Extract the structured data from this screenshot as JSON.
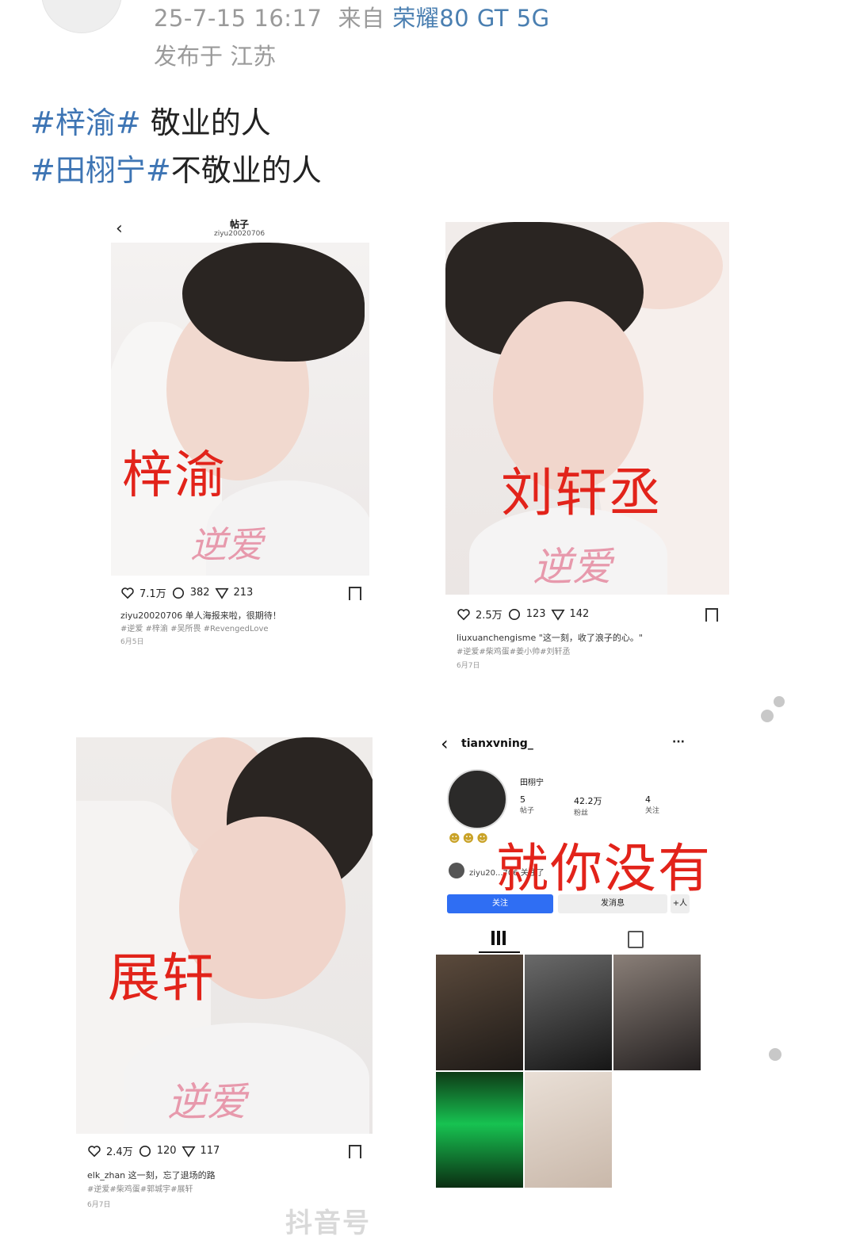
{
  "post": {
    "timestamp": "25-7-15 16:17",
    "source_prefix": "来自",
    "device": "荣耀80 GT 5G",
    "location": "发布于 江苏",
    "lines": [
      {
        "tag": "#梓渝#",
        "text": " 敬业的人"
      },
      {
        "tag": "#田栩宁#",
        "text": "不敬业的人"
      }
    ]
  },
  "cards": {
    "card1": {
      "nav_back": "‹",
      "nav_title": "帖子",
      "nav_user": "ziyu20020706",
      "label": "梓渝",
      "poster_script": "逆爱",
      "likes": "7.1万",
      "comments": "382",
      "shares": "213",
      "caption": "ziyu20020706 单人海报来啦，很期待！",
      "hashtags": "#逆爱 #梓渝 #吴所畏 #RevengedLove",
      "date": "6月5日"
    },
    "card2": {
      "label": "刘轩丞",
      "poster_script": "逆爱",
      "likes": "2.5万",
      "comments": "123",
      "shares": "142",
      "caption": "liuxuanchengisme \"这一刻，收了浪子的心。\"",
      "hashtags": "#逆爱#柴鸡蛋#姜小帅#刘轩丞",
      "date": "6月7日"
    },
    "card3": {
      "label": "展轩",
      "poster_script": "逆爱",
      "likes": "2.4万",
      "comments": "120",
      "shares": "117",
      "caption": "elk_zhan 这一刻，忘了退场的路",
      "hashtags": "#逆爱#柴鸡蛋#郭城宇#展轩",
      "date": "6月7日"
    },
    "card4": {
      "back": "‹",
      "username": "tianxvning_",
      "more": "···",
      "display_name": "田栩宁",
      "stats": [
        {
          "num": "5",
          "label": "帖子"
        },
        {
          "num": "42.2万",
          "label": "粉丝"
        },
        {
          "num": "4",
          "label": "关注"
        }
      ],
      "overlay": "就你没有",
      "followed_by": "ziyu20...706 关注了",
      "follow_btn": "关注",
      "message_btn": "发消息",
      "add_btn": "+人"
    }
  },
  "watermark": "抖音号",
  "colors": {
    "accent_blue": "#3e75b4",
    "label_red": "#e2231a",
    "meta_gray": "#9a9a9a",
    "follow_blue": "#2f6ef3"
  }
}
